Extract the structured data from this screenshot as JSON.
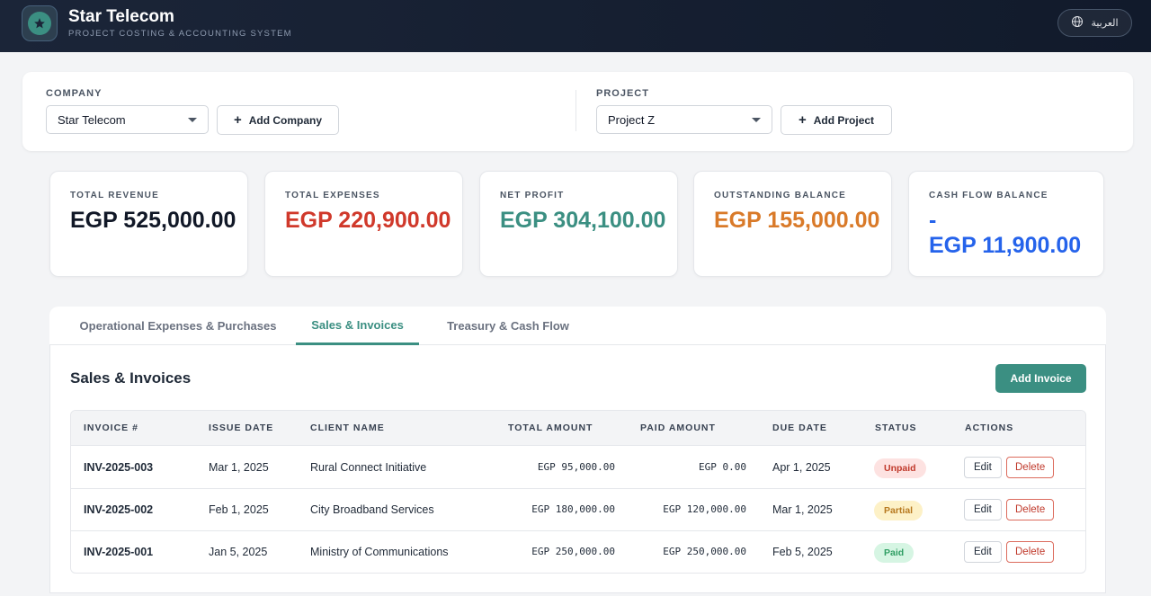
{
  "app": {
    "title": "Star Telecom",
    "subtitle": "PROJECT COSTING & ACCOUNTING SYSTEM",
    "language_label": "العربية"
  },
  "selectors": {
    "company_label": "COMPANY",
    "company_value": "Star Telecom",
    "add_company_label": "Add Company",
    "project_label": "PROJECT",
    "project_value": "Project Z",
    "add_project_label": "Add Project"
  },
  "kpis": [
    {
      "label": "TOTAL REVENUE",
      "value": "EGP 525,000.00",
      "color": "#111827"
    },
    {
      "label": "TOTAL EXPENSES",
      "value": "EGP 220,900.00",
      "color": "#d0392b"
    },
    {
      "label": "NET PROFIT",
      "value": "EGP 304,100.00",
      "color": "#3b8f82"
    },
    {
      "label": "OUTSTANDING BALANCE",
      "value": "EGP 155,000.00",
      "color": "#d97a29"
    },
    {
      "label": "CASH FLOW BALANCE",
      "value_line1": "-",
      "value": "EGP 11,900.00",
      "color": "#2563eb"
    }
  ],
  "tabs": [
    {
      "label": "Operational Expenses & Purchases",
      "active": false
    },
    {
      "label": "Sales & Invoices",
      "active": true
    },
    {
      "label": "Treasury & Cash Flow",
      "active": false
    }
  ],
  "section": {
    "title": "Sales & Invoices",
    "add_invoice_label": "Add Invoice"
  },
  "table": {
    "columns": [
      "INVOICE #",
      "ISSUE DATE",
      "CLIENT NAME",
      "TOTAL AMOUNT",
      "PAID AMOUNT",
      "DUE DATE",
      "STATUS",
      "ACTIONS"
    ],
    "rows": [
      {
        "invoice": "INV-2025-003",
        "issue_date": "Mar 1, 2025",
        "client": "Rural Connect Initiative",
        "total": "EGP 95,000.00",
        "paid": "EGP 0.00",
        "due_date": "Apr 1, 2025",
        "status": "Unpaid",
        "edit": "Edit",
        "delete": "Delete"
      },
      {
        "invoice": "INV-2025-002",
        "issue_date": "Feb 1, 2025",
        "client": "City Broadband Services",
        "total": "EGP 180,000.00",
        "paid": "EGP 120,000.00",
        "due_date": "Mar 1, 2025",
        "status": "Partial",
        "edit": "Edit",
        "delete": "Delete"
      },
      {
        "invoice": "INV-2025-001",
        "issue_date": "Jan 5, 2025",
        "client": "Ministry of Communications",
        "total": "EGP 250,000.00",
        "paid": "EGP 250,000.00",
        "due_date": "Feb 5, 2025",
        "status": "Paid",
        "edit": "Edit",
        "delete": "Delete"
      }
    ]
  },
  "colors": {
    "accent": "#3b8f82",
    "unpaid_bg": "#fde2e1",
    "unpaid_fg": "#c0392b",
    "partial_bg": "#fdf1c7",
    "partial_fg": "#b7791f",
    "paid_bg": "#d6f5e3",
    "paid_fg": "#2f9e63"
  },
  "icons": {
    "logo": "star-icon",
    "language": "globe-icon",
    "add": "plus-icon",
    "dropdown": "chevron-down-icon"
  }
}
